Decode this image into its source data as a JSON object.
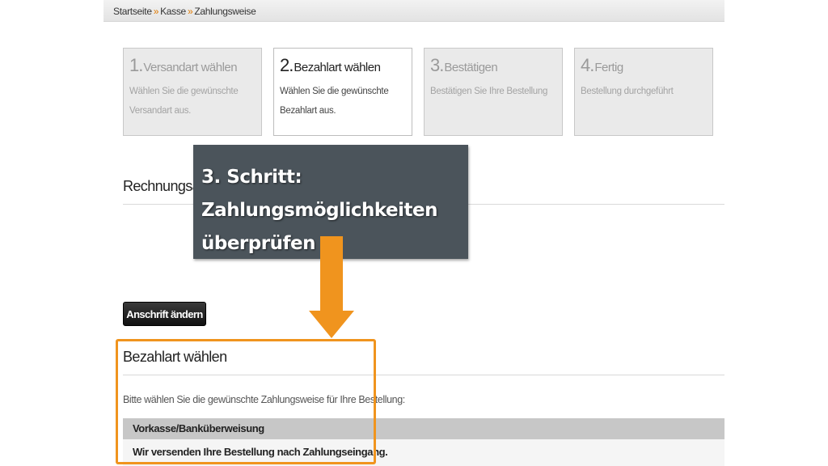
{
  "breadcrumb": {
    "items": [
      "Startseite",
      "Kasse",
      "Zahlungsweise"
    ],
    "separator": "»"
  },
  "steps": [
    {
      "num": "1.",
      "title": "Versandart wählen",
      "desc": "Wählen Sie die gewünschte Versandart aus.",
      "active": false
    },
    {
      "num": "2.",
      "title": "Bezahlart wählen",
      "desc": "Wählen Sie die gewünschte Bezahlart aus.",
      "active": true
    },
    {
      "num": "3.",
      "title": "Bestätigen",
      "desc": "Bestätigen Sie Ihre Bestellung",
      "active": false
    },
    {
      "num": "4.",
      "title": "Fertig",
      "desc": "Bestellung durchgeführt",
      "active": false
    }
  ],
  "billing": {
    "heading": "Rechnungsa",
    "change_button": "Anschrift ändern"
  },
  "payment": {
    "heading": "Bezahlart wählen",
    "hint": "Bitte wählen Sie die gewünschte Zahlungsweise für Ihre Bestellung:",
    "option_label": "Vorkasse/Banküberweisung",
    "option_desc": "Wir versenden Ihre Bestellung nach Zahlungseingang."
  },
  "callout": {
    "lines": [
      "3. Schritt:",
      "Zahlungsmöglichkeiten",
      "überprüfen"
    ]
  },
  "colors": {
    "accent_orange": "#f0941e",
    "callout_bg": "#4b545b",
    "breadcrumb_separator": "#e07a00"
  }
}
